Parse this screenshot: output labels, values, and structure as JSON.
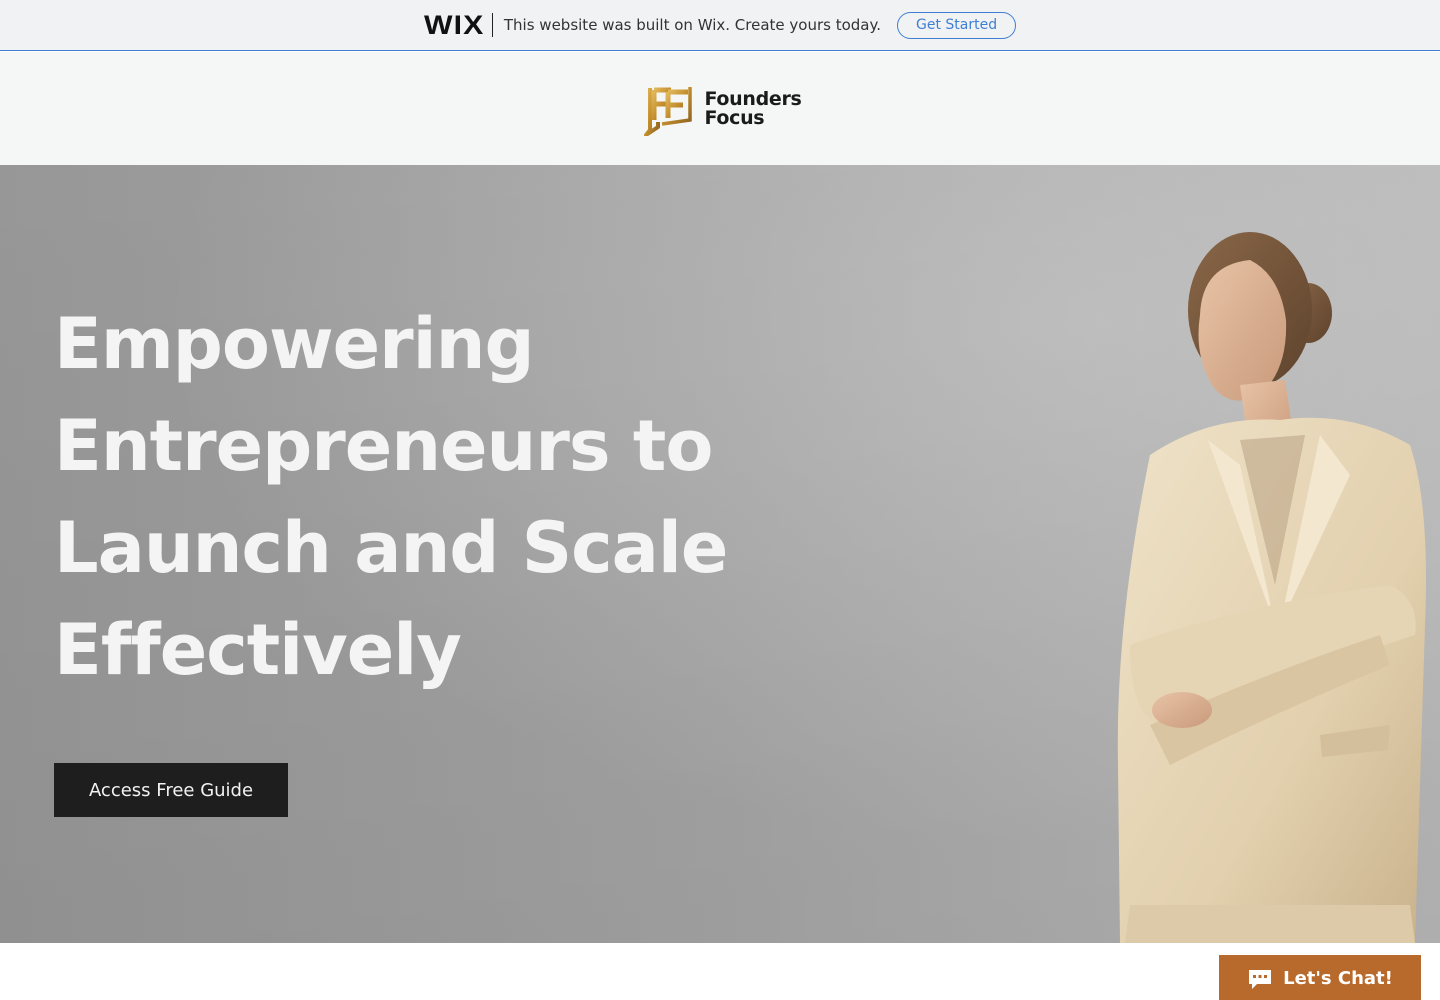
{
  "wix_banner": {
    "logo": "WIX",
    "message": "This website was built on Wix. Create yours today.",
    "cta_label": "Get Started"
  },
  "header": {
    "brand_line1": "Founders",
    "brand_line2": "Focus",
    "logo_icon": "founders-focus-monogram"
  },
  "hero": {
    "title_lines": [
      "Empowering",
      "Entrepreneurs to",
      "Launch and Scale",
      "Effectively"
    ],
    "cta_label": "Access Free Guide",
    "image": "woman-in-beige-suit-photo"
  },
  "chat": {
    "label": "Let's Chat!",
    "icon": "chat-bubble-icon"
  },
  "colors": {
    "wix_accent": "#3f7fd3",
    "brand_gold": "#c7952e",
    "cta_dark": "#1e1e1e",
    "chat_bg": "#b86a2c"
  }
}
